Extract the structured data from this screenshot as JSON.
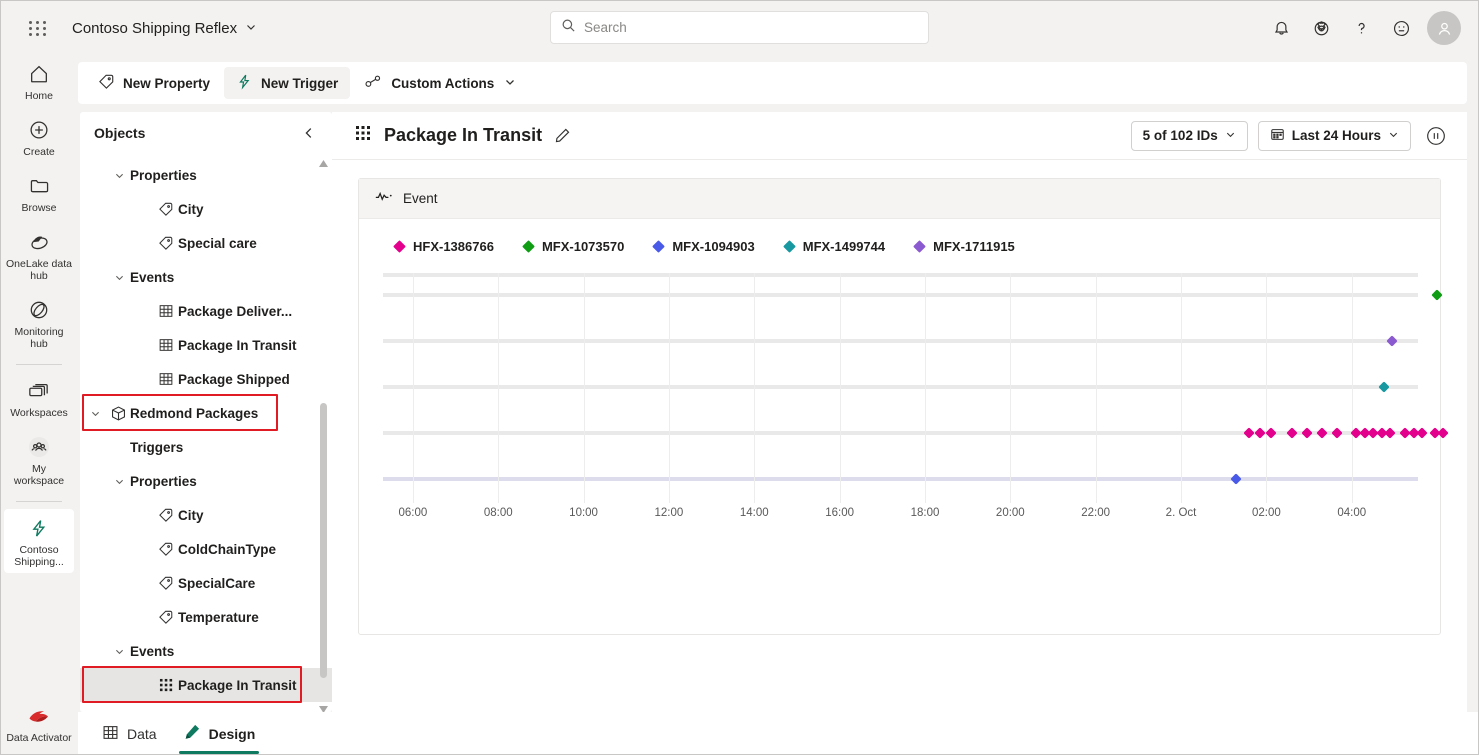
{
  "app": {
    "title": "Contoso Shipping Reflex",
    "waffle_icon": "waffle-grid-icon",
    "chevron_icon": "chevron-down-icon"
  },
  "search": {
    "placeholder": "Search",
    "value": "",
    "icon": "search-icon"
  },
  "topright": [
    {
      "name": "notifications",
      "icon": "bell-icon"
    },
    {
      "name": "settings",
      "icon": "gear-icon"
    },
    {
      "name": "help",
      "icon": "question-icon"
    },
    {
      "name": "feedback",
      "icon": "smiley-icon"
    },
    {
      "name": "account",
      "icon": "avatar-icon"
    }
  ],
  "rail": {
    "items": [
      {
        "label": "Home",
        "icon": "home-icon",
        "active": false
      },
      {
        "label": "Create",
        "icon": "plus-circle-icon",
        "active": false
      },
      {
        "label": "Browse",
        "icon": "folder-icon",
        "active": false
      },
      {
        "label": "OneLake data hub",
        "icon": "onelake-icon",
        "active": false
      },
      {
        "label": "Monitoring hub",
        "icon": "monitoring-icon",
        "active": false
      },
      {
        "label": "Workspaces",
        "icon": "workspaces-icon",
        "active": false
      },
      {
        "label": "My workspace",
        "icon": "people-icon",
        "active": false
      },
      {
        "label": "Contoso Shipping...",
        "icon": "reflex-bolt-icon",
        "active": true
      }
    ],
    "bottom": {
      "label": "Data Activator",
      "icon": "data-activator-icon"
    }
  },
  "commandbar": {
    "items": [
      {
        "label": "New Property",
        "icon": "tag-icon",
        "selected": false,
        "has_chevron": false
      },
      {
        "label": "New Trigger",
        "icon": "bolt-icon",
        "selected": true,
        "has_chevron": false
      },
      {
        "label": "Custom Actions",
        "icon": "actions-icon",
        "selected": false,
        "has_chevron": true
      }
    ]
  },
  "objects_panel": {
    "title": "Objects",
    "collapse_icon": "chevron-left-icon",
    "tree": [
      {
        "label": "Properties",
        "level": 1,
        "icon": "",
        "chevron": "chevron-down-icon",
        "selected": false,
        "highlighted": false
      },
      {
        "label": "City",
        "level": 2,
        "icon": "tag-icon",
        "chevron": "",
        "selected": false,
        "highlighted": false
      },
      {
        "label": "Special care",
        "level": 2,
        "icon": "tag-icon",
        "chevron": "",
        "selected": false,
        "highlighted": false
      },
      {
        "label": "Events",
        "level": 1,
        "icon": "",
        "chevron": "chevron-down-icon",
        "selected": false,
        "highlighted": false
      },
      {
        "label": "Package Deliver...",
        "level": 2,
        "icon": "grid-icon",
        "chevron": "",
        "selected": false,
        "highlighted": false
      },
      {
        "label": "Package In Transit",
        "level": 2,
        "icon": "grid-icon",
        "chevron": "",
        "selected": false,
        "highlighted": false
      },
      {
        "label": "Package Shipped",
        "level": 2,
        "icon": "grid-icon",
        "chevron": "",
        "selected": false,
        "highlighted": false
      },
      {
        "label": "Redmond Packages",
        "level": 0,
        "icon": "cube-icon",
        "chevron": "chevron-down-icon",
        "selected": false,
        "highlighted": true
      },
      {
        "label": "Triggers",
        "level": 1,
        "icon": "",
        "chevron": "",
        "selected": false,
        "highlighted": false
      },
      {
        "label": "Properties",
        "level": 1,
        "icon": "",
        "chevron": "chevron-down-icon",
        "selected": false,
        "highlighted": false
      },
      {
        "label": "City",
        "level": 2,
        "icon": "tag-icon",
        "chevron": "",
        "selected": false,
        "highlighted": false
      },
      {
        "label": "ColdChainType",
        "level": 2,
        "icon": "tag-icon",
        "chevron": "",
        "selected": false,
        "highlighted": false
      },
      {
        "label": "SpecialCare",
        "level": 2,
        "icon": "tag-icon",
        "chevron": "",
        "selected": false,
        "highlighted": false
      },
      {
        "label": "Temperature",
        "level": 2,
        "icon": "tag-icon",
        "chevron": "",
        "selected": false,
        "highlighted": false
      },
      {
        "label": "Events",
        "level": 1,
        "icon": "",
        "chevron": "chevron-down-icon",
        "selected": false,
        "highlighted": false
      },
      {
        "label": "Package In Transit",
        "level": 2,
        "icon": "grid-dots-icon",
        "chevron": "",
        "selected": true,
        "highlighted": true
      }
    ],
    "highlight_color": "#e01b24"
  },
  "content": {
    "title": "Package In Transit",
    "title_icon": "grid-dots-icon",
    "edit_icon": "pencil-icon",
    "id_filter": {
      "label": "5 of 102 IDs",
      "chevron": "chevron-down-icon"
    },
    "time_filter": {
      "label": "Last 24 Hours",
      "icon": "calendar-icon",
      "chevron": "chevron-down-icon"
    },
    "pause_button": {
      "name": "pause-button",
      "icon": "pause-icon"
    }
  },
  "chart_card": {
    "title": "Event",
    "icon": "sparkline-icon"
  },
  "bottom_tabs": [
    {
      "label": "Data",
      "icon": "grid-icon",
      "active": false
    },
    {
      "label": "Design",
      "icon": "design-pen-icon",
      "active": true
    }
  ],
  "chart_data": {
    "type": "scatter",
    "title": "Event",
    "xlabel": "",
    "ylabel": "",
    "grid": true,
    "legend_position": "top",
    "x_axis": {
      "type": "time",
      "ticks": [
        "06:00",
        "08:00",
        "10:00",
        "12:00",
        "14:00",
        "16:00",
        "18:00",
        "20:00",
        "22:00",
        "2. Oct",
        "02:00",
        "04:00"
      ],
      "range_hours": [
        5.3,
        29.6
      ]
    },
    "y_axis": {
      "type": "categorical",
      "categories": [
        "MFX-1094903",
        "HFX-1386766",
        "MFX-1499744",
        "MFX-1711915",
        "MFX-1073570"
      ],
      "ticks_visible": false
    },
    "series": [
      {
        "name": "HFX-1386766",
        "color": "#e3008c",
        "marker": "diamond",
        "y_level": "HFX-1386766",
        "points_hours": [
          25.6,
          25.85,
          26.1,
          26.6,
          26.95,
          27.3,
          27.65,
          28.1,
          28.3,
          28.5,
          28.7,
          28.9,
          29.25,
          29.45,
          29.65,
          29.95,
          30.15
        ]
      },
      {
        "name": "MFX-1073570",
        "color": "#0f9d14",
        "marker": "diamond",
        "y_level": "MFX-1073570",
        "points_hours": [
          30.0
        ]
      },
      {
        "name": "MFX-1094903",
        "color": "#4a5ae8",
        "marker": "diamond",
        "y_level": "MFX-1094903",
        "points_hours": [
          25.3
        ]
      },
      {
        "name": "MFX-1499744",
        "color": "#1898a0",
        "marker": "diamond",
        "y_level": "MFX-1499744",
        "points_hours": [
          28.75
        ]
      },
      {
        "name": "MFX-1711915",
        "color": "#8b5ad0",
        "marker": "diamond",
        "y_level": "MFX-1711915",
        "points_hours": [
          28.95
        ]
      }
    ]
  }
}
